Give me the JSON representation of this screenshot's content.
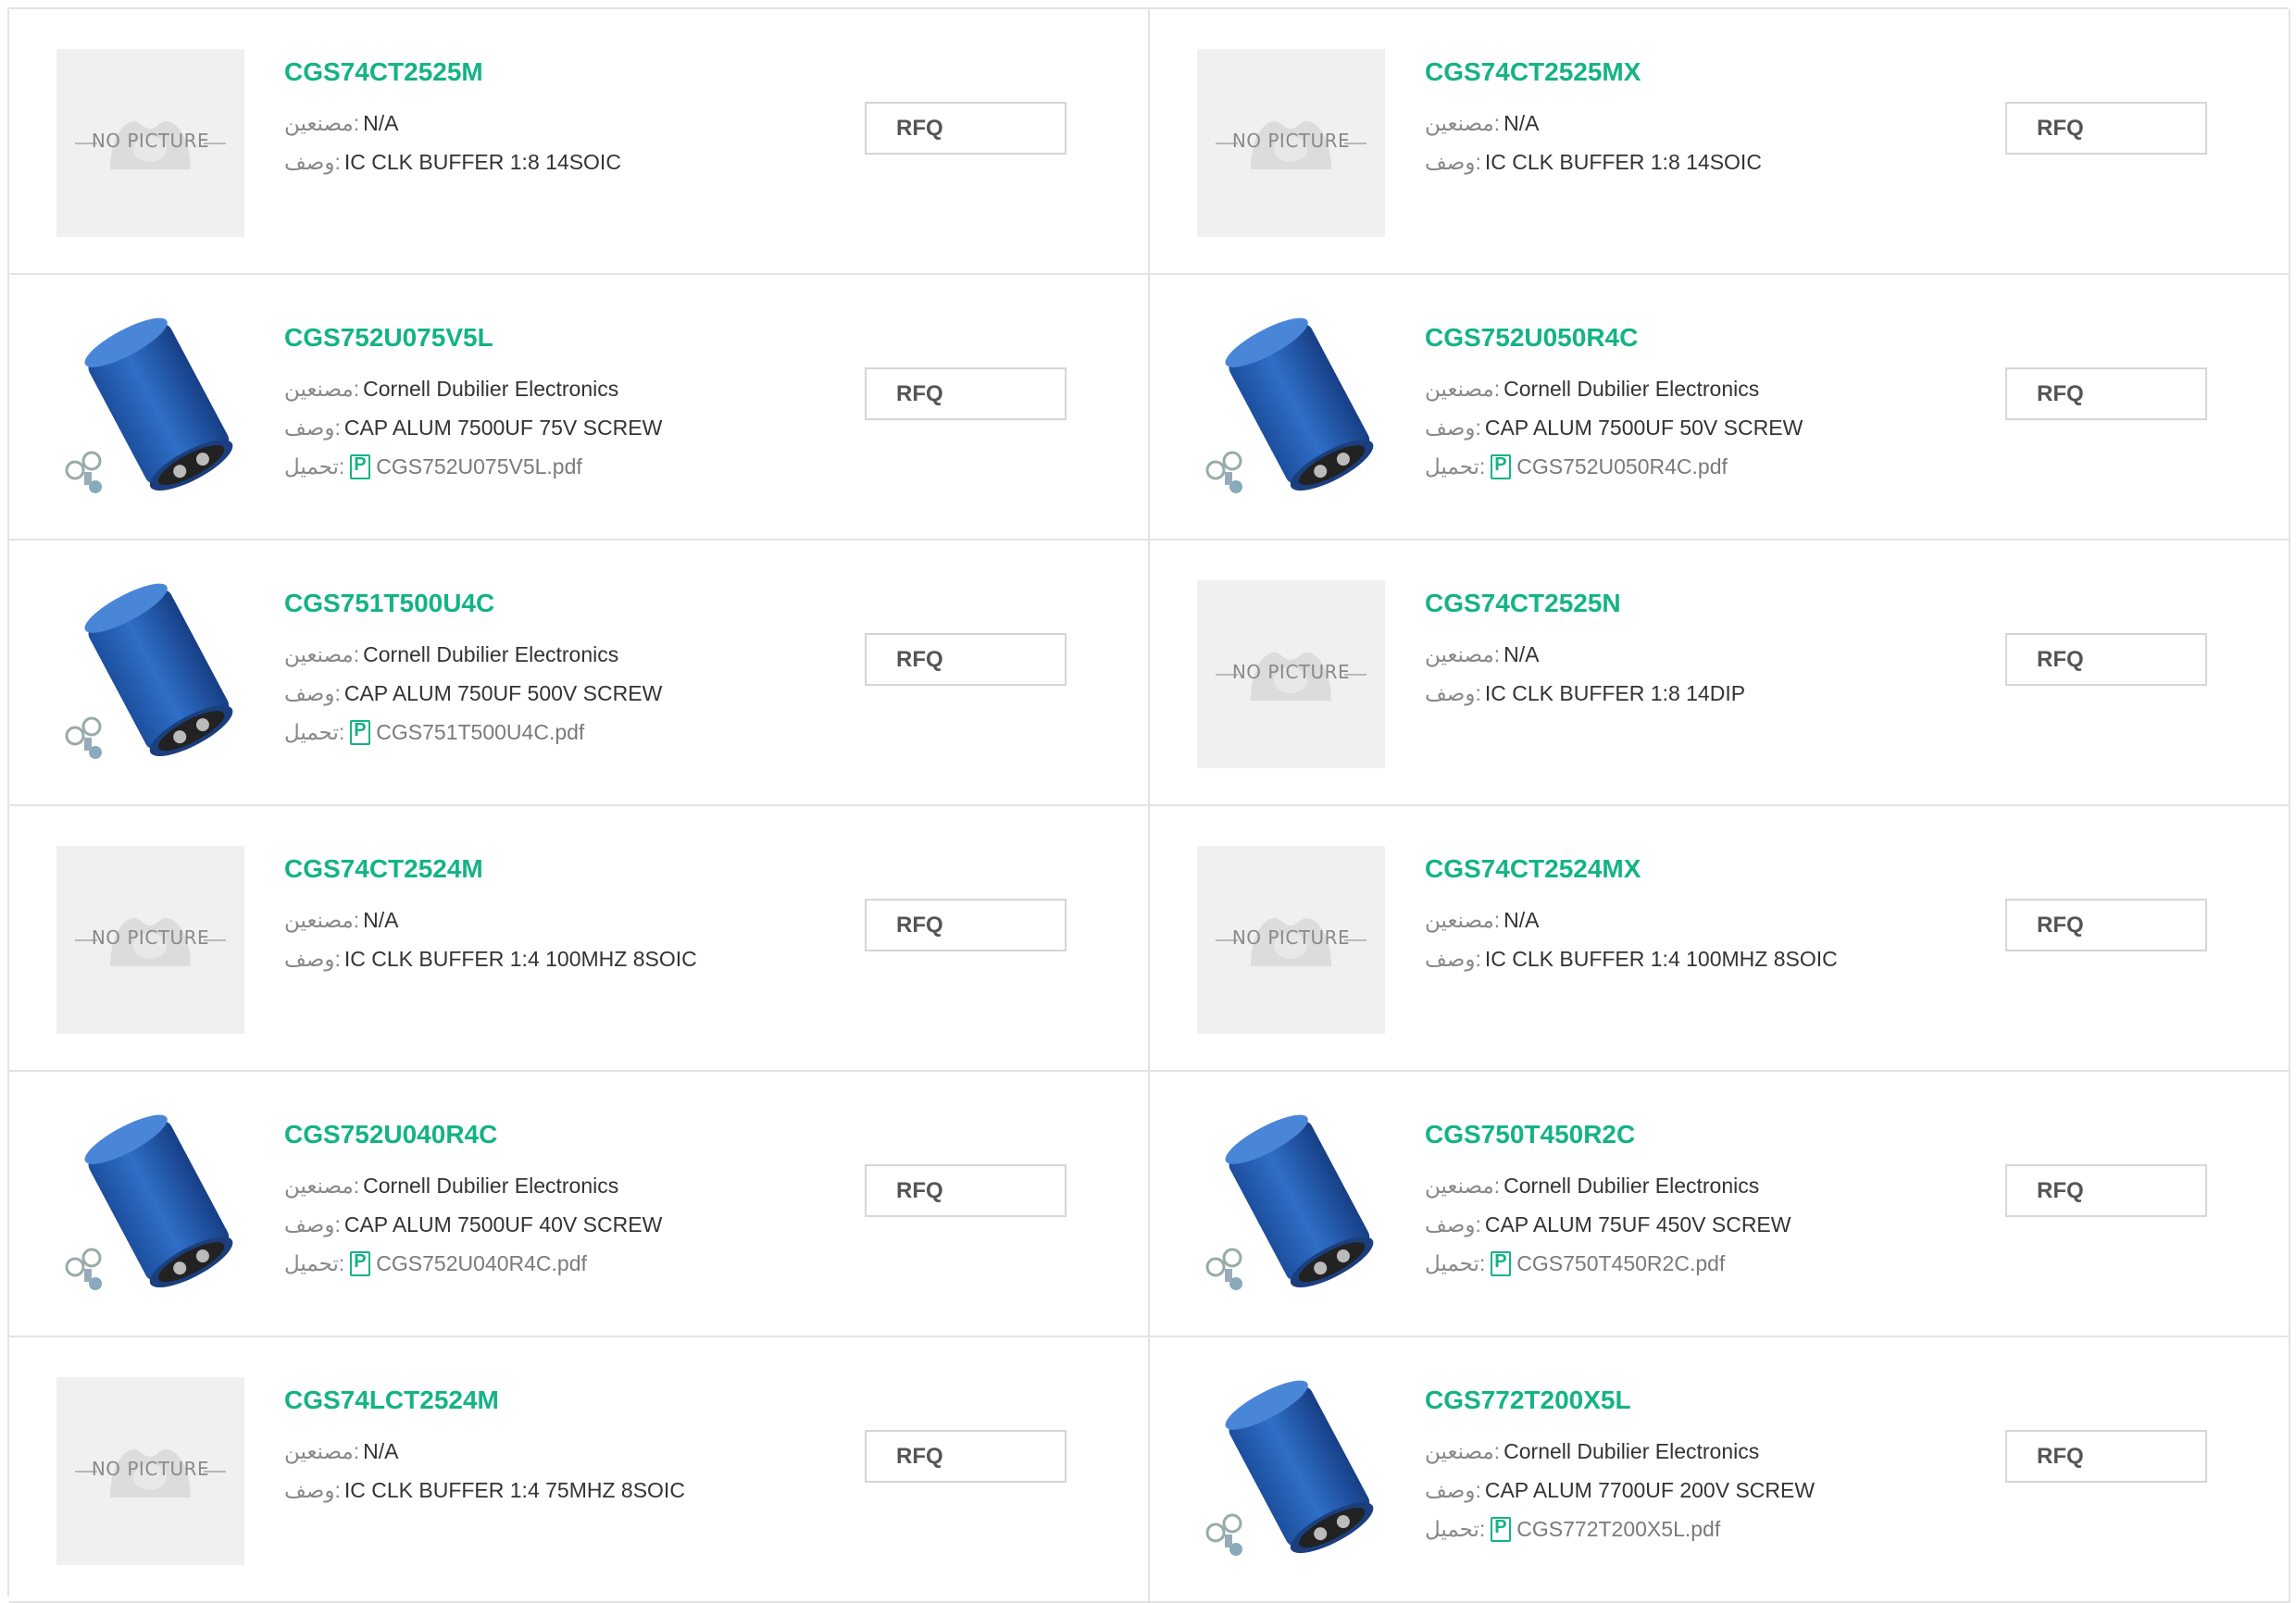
{
  "labels": {
    "manufacturer": "مصنعين:",
    "description": "وصف:",
    "download": "تحميل:",
    "rfq": "RFQ",
    "no_picture": "NO PICTURE"
  },
  "colors": {
    "part_link": "#14b386",
    "capacitor_blue": "#2f6fc8",
    "border": "#e3e3e3"
  },
  "products": [
    {
      "part": "CGS74CT2525M",
      "manufacturer": "N/A",
      "description": "IC CLK BUFFER 1:8 14SOIC",
      "image": "no-picture",
      "datasheet": null
    },
    {
      "part": "CGS74CT2525MX",
      "manufacturer": "N/A",
      "description": "IC CLK BUFFER 1:8 14SOIC",
      "image": "no-picture",
      "datasheet": null
    },
    {
      "part": "CGS752U075V5L",
      "manufacturer": "Cornell Dubilier Electronics",
      "description": "CAP ALUM 7500UF 75V SCREW",
      "image": "capacitor",
      "datasheet": "CGS752U075V5L.pdf"
    },
    {
      "part": "CGS752U050R4C",
      "manufacturer": "Cornell Dubilier Electronics",
      "description": "CAP ALUM 7500UF 50V SCREW",
      "image": "capacitor",
      "datasheet": "CGS752U050R4C.pdf"
    },
    {
      "part": "CGS751T500U4C",
      "manufacturer": "Cornell Dubilier Electronics",
      "description": "CAP ALUM 750UF 500V SCREW",
      "image": "capacitor",
      "datasheet": "CGS751T500U4C.pdf"
    },
    {
      "part": "CGS74CT2525N",
      "manufacturer": "N/A",
      "description": "IC CLK BUFFER 1:8 14DIP",
      "image": "no-picture",
      "datasheet": null
    },
    {
      "part": "CGS74CT2524M",
      "manufacturer": "N/A",
      "description": "IC CLK BUFFER 1:4 100MHZ 8SOIC",
      "image": "no-picture",
      "datasheet": null
    },
    {
      "part": "CGS74CT2524MX",
      "manufacturer": "N/A",
      "description": "IC CLK BUFFER 1:4 100MHZ 8SOIC",
      "image": "no-picture",
      "datasheet": null
    },
    {
      "part": "CGS752U040R4C",
      "manufacturer": "Cornell Dubilier Electronics",
      "description": "CAP ALUM 7500UF 40V SCREW",
      "image": "capacitor",
      "datasheet": "CGS752U040R4C.pdf"
    },
    {
      "part": "CGS750T450R2C",
      "manufacturer": "Cornell Dubilier Electronics",
      "description": "CAP ALUM 75UF 450V SCREW",
      "image": "capacitor",
      "datasheet": "CGS750T450R2C.pdf"
    },
    {
      "part": "CGS74LCT2524M",
      "manufacturer": "N/A",
      "description": "IC CLK BUFFER 1:4 75MHZ 8SOIC",
      "image": "no-picture",
      "datasheet": null
    },
    {
      "part": "CGS772T200X5L",
      "manufacturer": "Cornell Dubilier Electronics",
      "description": "CAP ALUM 7700UF 200V SCREW",
      "image": "capacitor",
      "datasheet": "CGS772T200X5L.pdf"
    }
  ]
}
